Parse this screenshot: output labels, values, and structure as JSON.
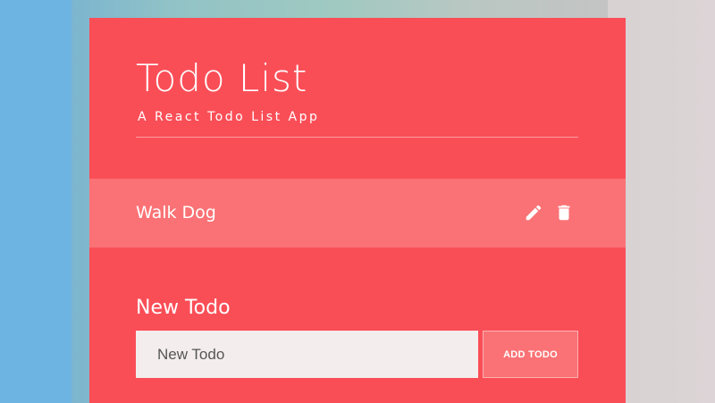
{
  "app": {
    "title": "Todo List",
    "subtitle": "A React Todo List App"
  },
  "todos": [
    {
      "text": "Walk Dog",
      "edit_icon": "pencil-icon",
      "delete_icon": "trash-icon"
    }
  ],
  "new_todo": {
    "label": "New Todo",
    "input_value": "",
    "input_placeholder": "New Todo",
    "add_button_label": "ADD TODO"
  },
  "colors": {
    "card": "#fa4e57",
    "todo_item": "#fa7275",
    "input_bg": "#f3eded"
  }
}
